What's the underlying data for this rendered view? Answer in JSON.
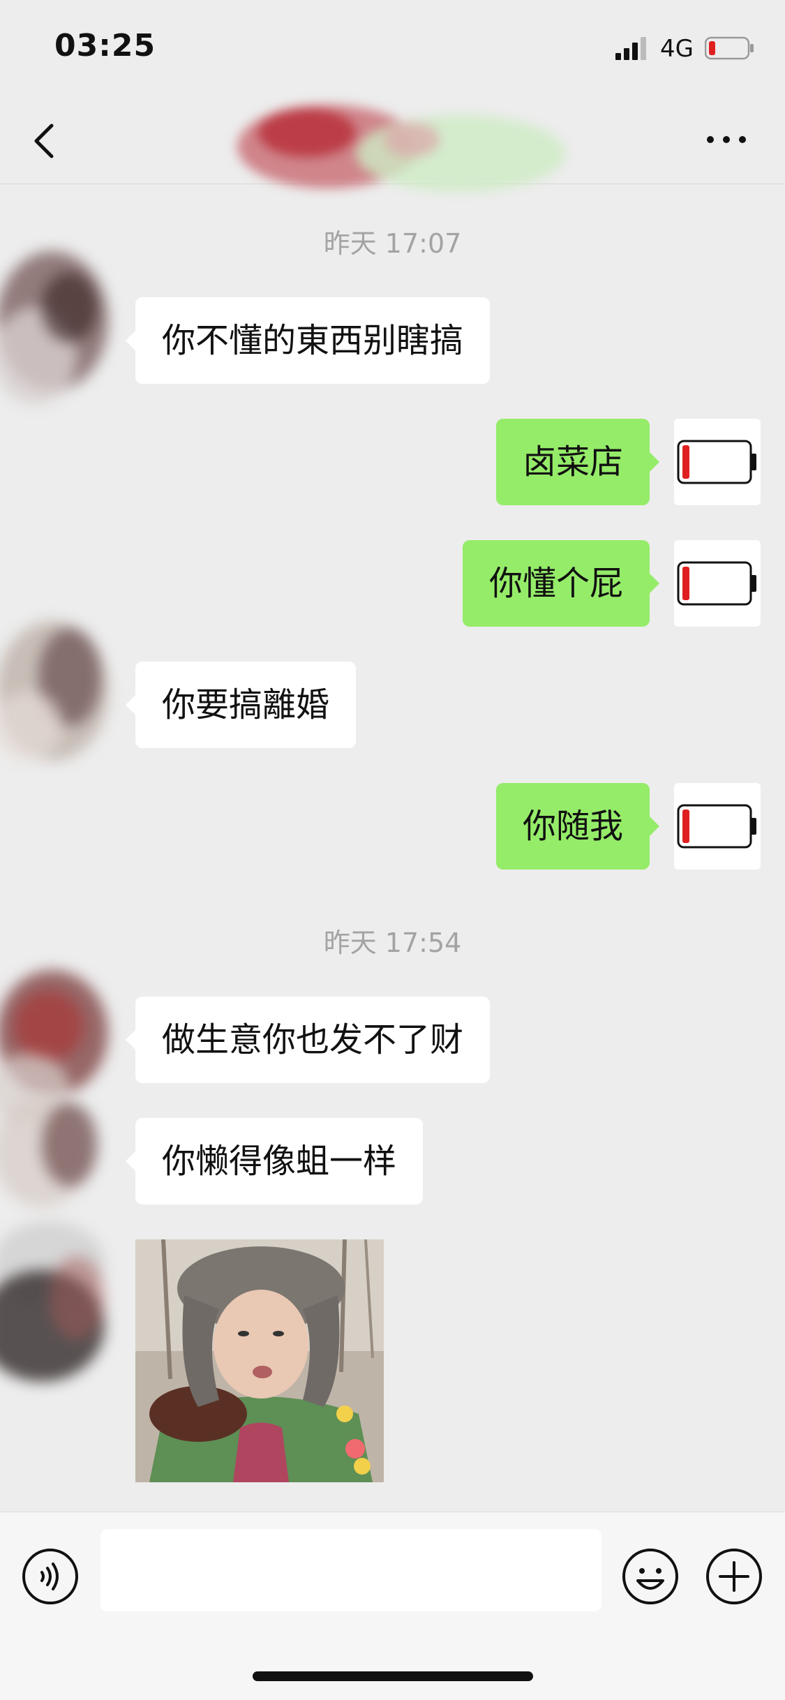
{
  "status_bar": {
    "time": "03:25",
    "network": "4G",
    "battery_color": "#e02020"
  },
  "nav": {
    "back_icon": "chevron-left-icon",
    "more_icon": "ellipsis-icon"
  },
  "timestamps": [
    "昨天 17:07",
    "昨天 17:54"
  ],
  "messages": [
    {
      "side": "in",
      "text": "你不懂的東西别瞎搞"
    },
    {
      "side": "out",
      "text": "卤菜店"
    },
    {
      "side": "out",
      "text": "你懂个屁"
    },
    {
      "side": "in",
      "text": "你要搞離婚"
    },
    {
      "side": "out",
      "text": "你随我"
    },
    {
      "side": "in",
      "text": "做生意你也发不了财"
    },
    {
      "side": "in",
      "text": "你懒得像蛆一样"
    },
    {
      "side": "in",
      "type": "sticker"
    }
  ],
  "colors": {
    "out_bubble": "#95ec69",
    "in_bubble": "#ffffff",
    "background": "#ededed"
  },
  "input_bar": {
    "placeholder": ""
  }
}
